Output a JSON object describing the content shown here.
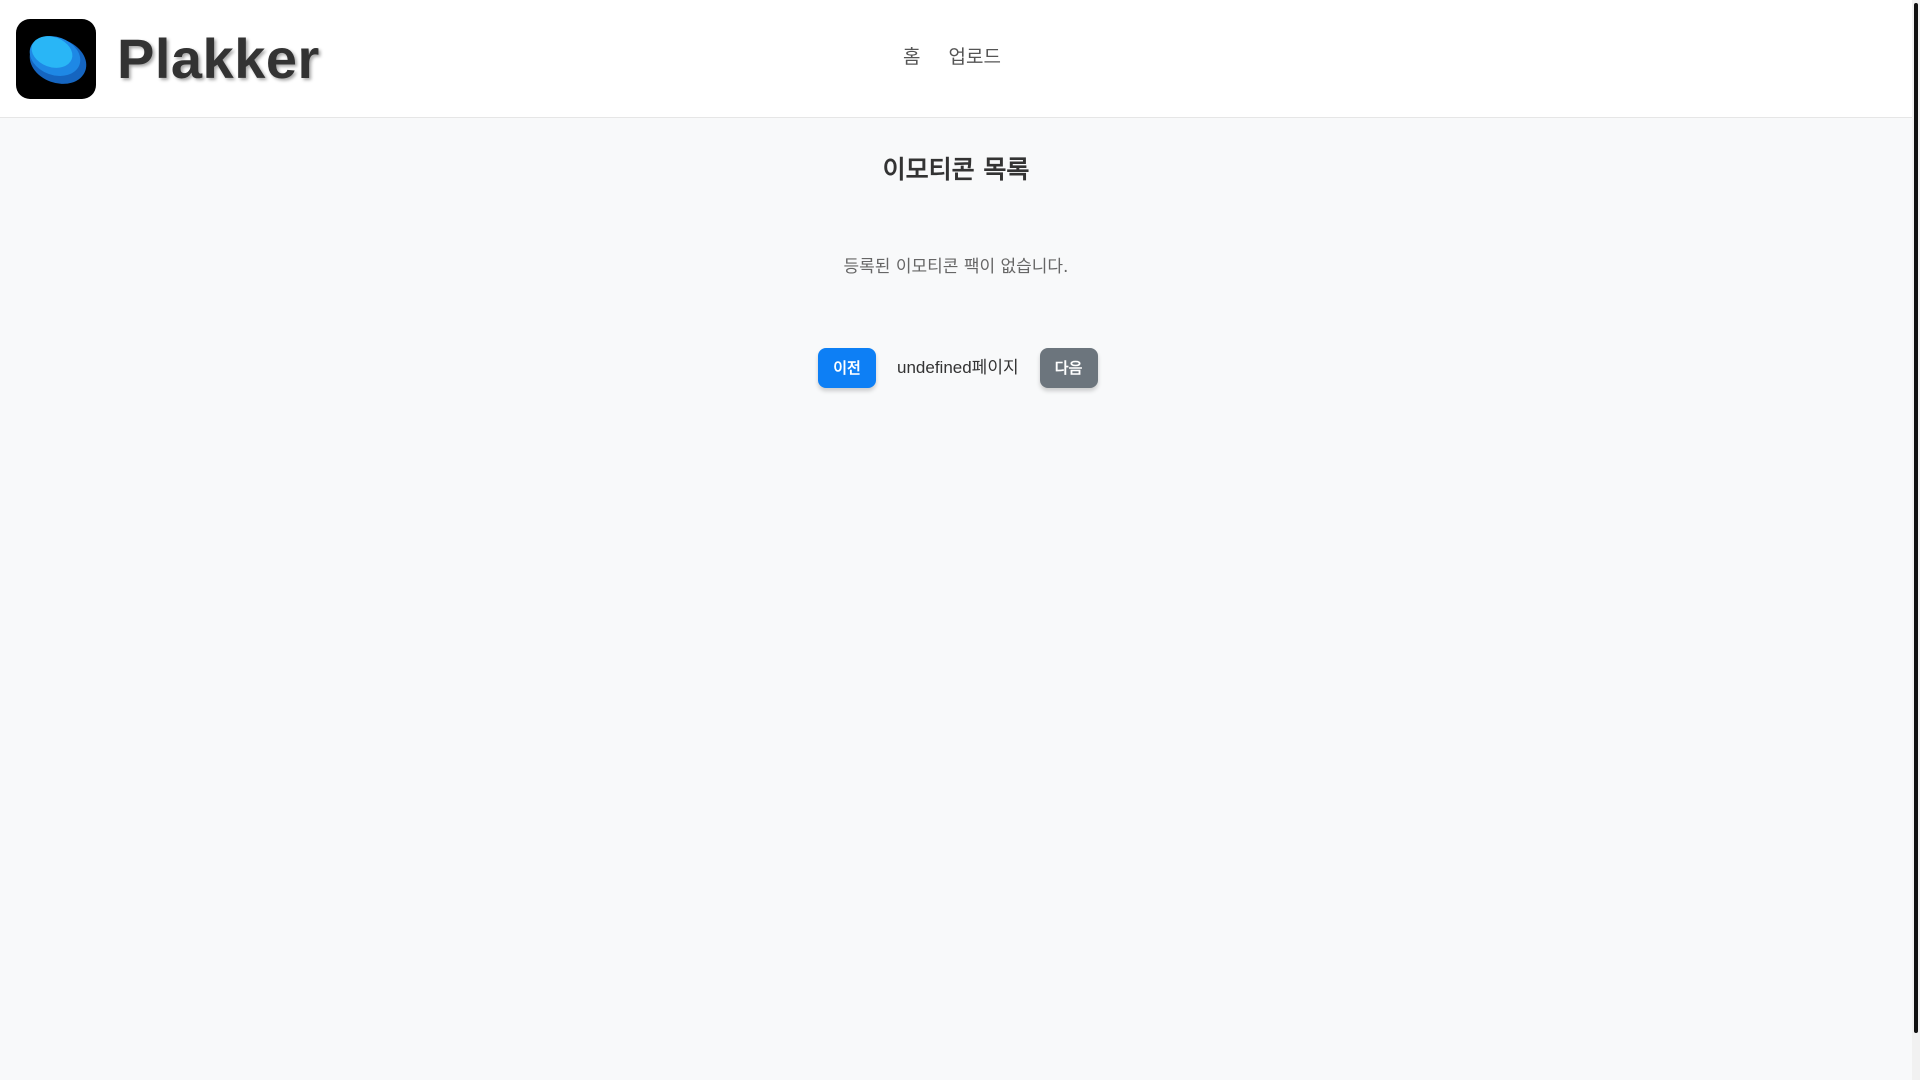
{
  "header": {
    "brand": "Plakker",
    "nav": [
      "홈",
      "업로드"
    ]
  },
  "main": {
    "title": "이모티콘 목록",
    "empty_message": "등록된 이모티콘 팩이 없습니다.",
    "pagination": {
      "prev_label": "이전",
      "page_info": "undefined페이지",
      "next_label": "다음"
    }
  },
  "colors": {
    "primary": "#0d7ff5",
    "secondary": "#6c757d",
    "background": "#f8f9fa"
  }
}
